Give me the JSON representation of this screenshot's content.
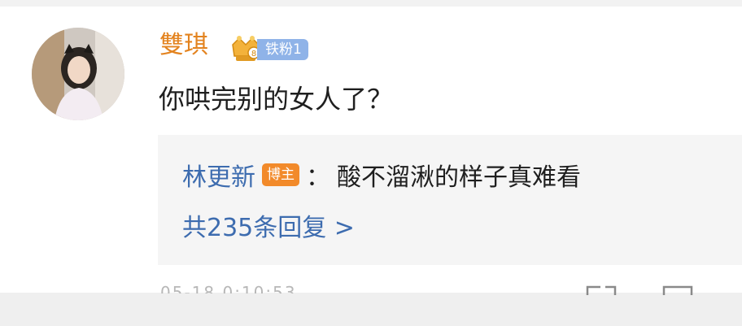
{
  "comment": {
    "username": "雙琪",
    "fan_badge": "铁粉1",
    "text": "你哄完别的女人了？",
    "avatar_icon": "user-avatar",
    "crown_icon": "crown-icon"
  },
  "reply": {
    "author": "林更新",
    "author_tag": "博主",
    "colon": "：",
    "text": "酸不溜湫的样子真难看",
    "count_label": "共235条回复 >"
  },
  "footer": {
    "time_text": "05-18 0:10:53",
    "share_icon": "share-icon",
    "comment_icon": "comment-icon"
  },
  "colors": {
    "username": "#e3831f",
    "link_blue": "#3d6caf",
    "badge_blue": "#8fb3e8",
    "blogger_orange": "#f28a2a",
    "reply_bg": "#f5f5f5"
  }
}
